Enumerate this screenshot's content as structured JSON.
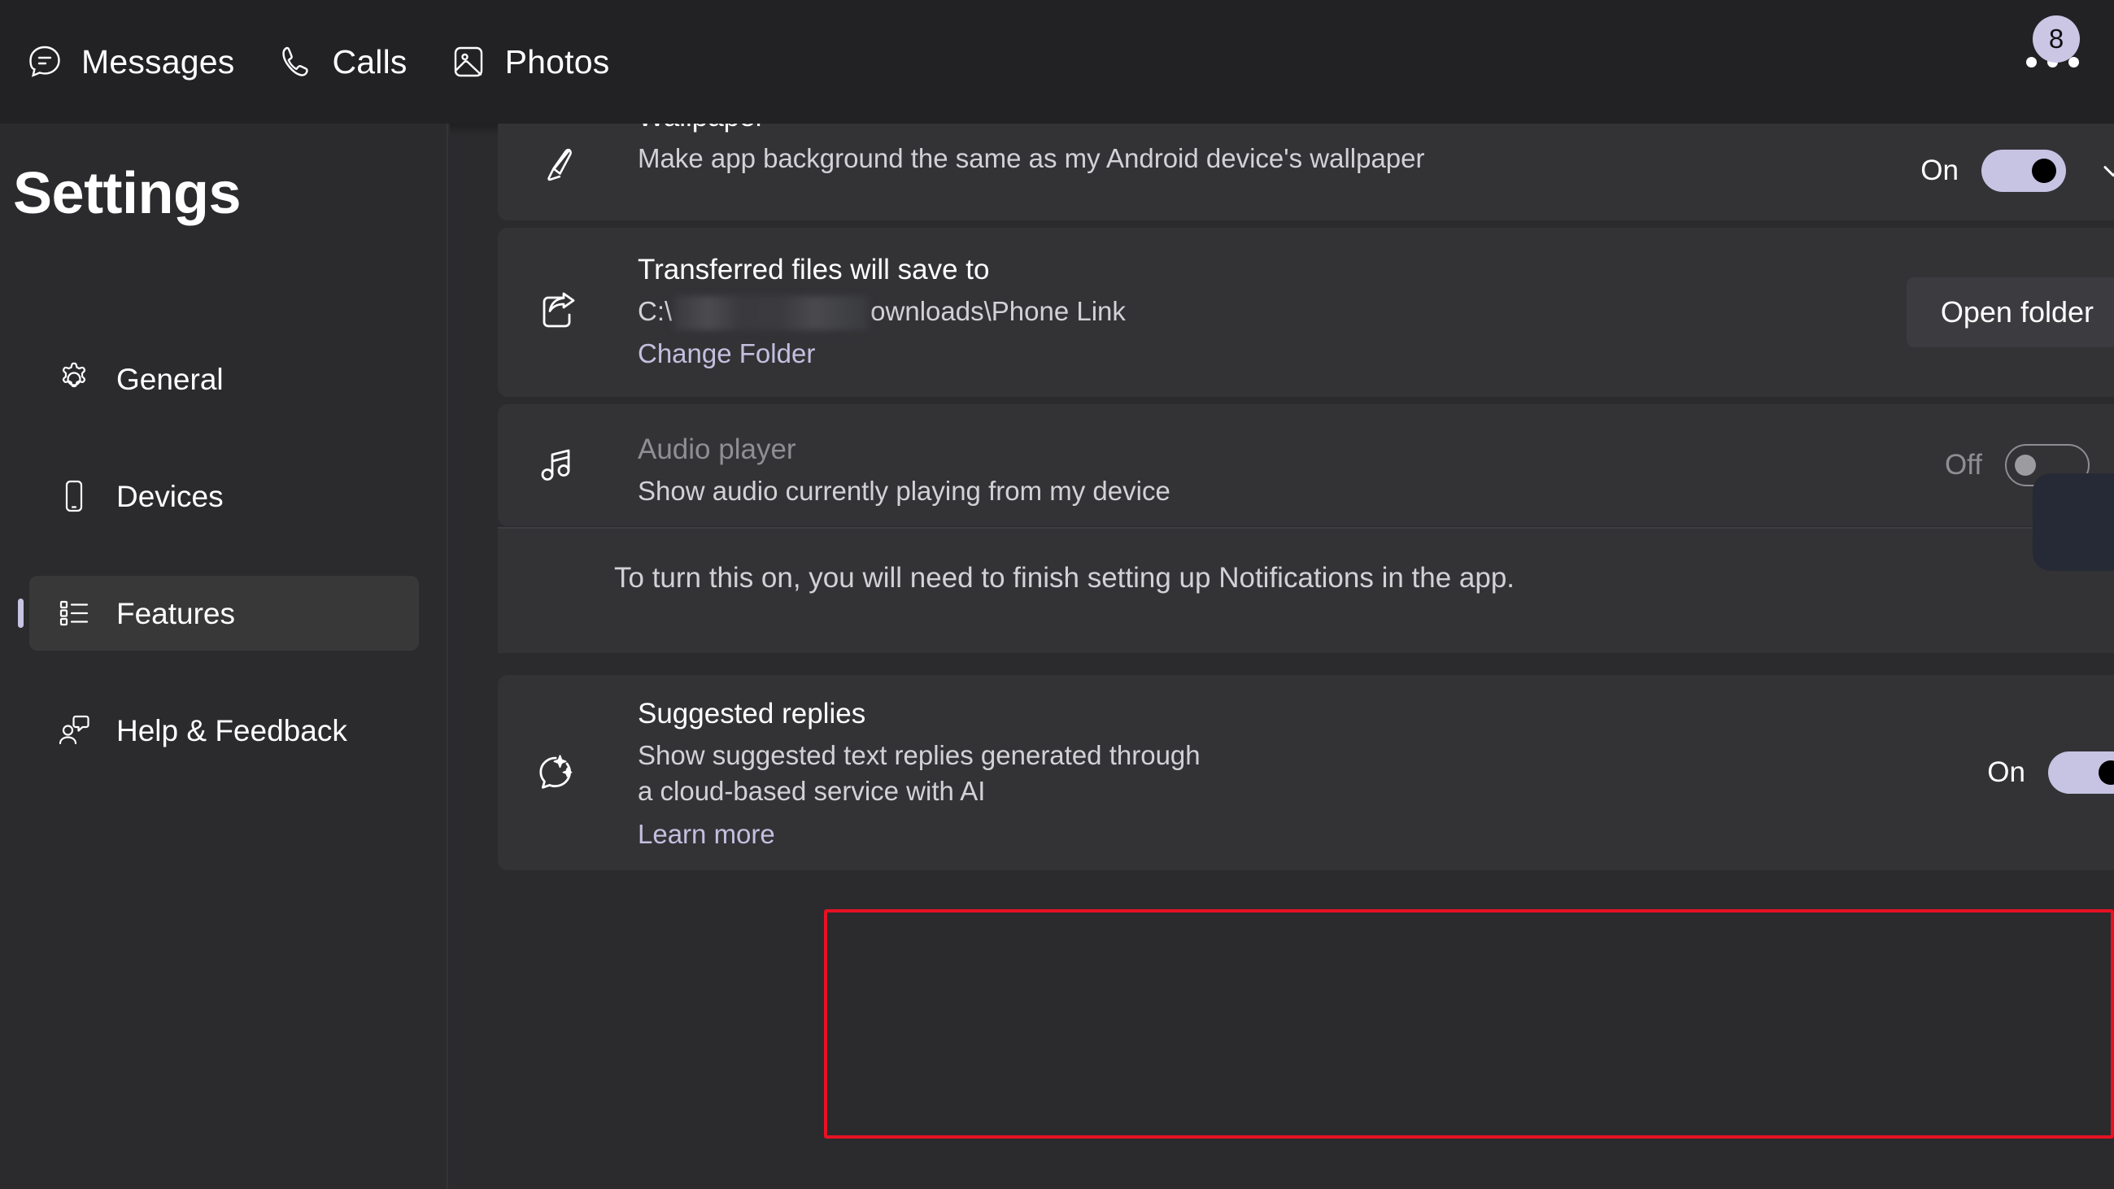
{
  "titlebar": {
    "tabs": [
      {
        "label": "Messages",
        "icon": "messages-icon"
      },
      {
        "label": "Calls",
        "icon": "calls-icon"
      },
      {
        "label": "Photos",
        "icon": "photos-icon"
      }
    ],
    "more_menu": {
      "icon": "more-options-icon",
      "badge_count": "8"
    }
  },
  "sidebar": {
    "title": "Settings",
    "items": [
      {
        "label": "General",
        "icon": "gear-icon",
        "selected": false
      },
      {
        "label": "Devices",
        "icon": "phone-icon",
        "selected": false
      },
      {
        "label": "Features",
        "icon": "list-icon",
        "selected": true
      },
      {
        "label": "Help & Feedback",
        "icon": "person-chat-icon",
        "selected": false
      }
    ]
  },
  "content": {
    "cards": [
      {
        "id": "wallpaper",
        "icon": "paintbrush-icon",
        "title": "Wallpaper",
        "desc": "Make app background the same as my Android device's wallpaper",
        "state_label": "On",
        "toggle": "on",
        "expander": "chevron-down-icon"
      },
      {
        "id": "transferred-files",
        "icon": "share-export-icon",
        "title": "Transferred files will save to",
        "path_prefix": "C:\\",
        "path_suffix": "ownloads\\Phone Link",
        "link": "Change Folder",
        "button": "Open folder"
      },
      {
        "id": "audio-player",
        "icon": "music-note-icon",
        "title": "Audio player",
        "desc": "Show audio currently playing from my device",
        "state_label": "Off",
        "toggle": "off",
        "disabled": true
      }
    ],
    "notice": "To turn this on, you will need to finish setting up Notifications in the app.",
    "suggested_replies": {
      "id": "suggested-replies",
      "icon": "chat-sparkle-icon",
      "title": "Suggested replies",
      "desc": "Show suggested text replies generated through a cloud-based service with AI",
      "link": "Learn more",
      "state_label": "On",
      "toggle": "on"
    }
  },
  "colors": {
    "accent": "#c7c3e3",
    "highlight": "#e81123",
    "surface": "#333336",
    "background": "#2b2b2e"
  }
}
